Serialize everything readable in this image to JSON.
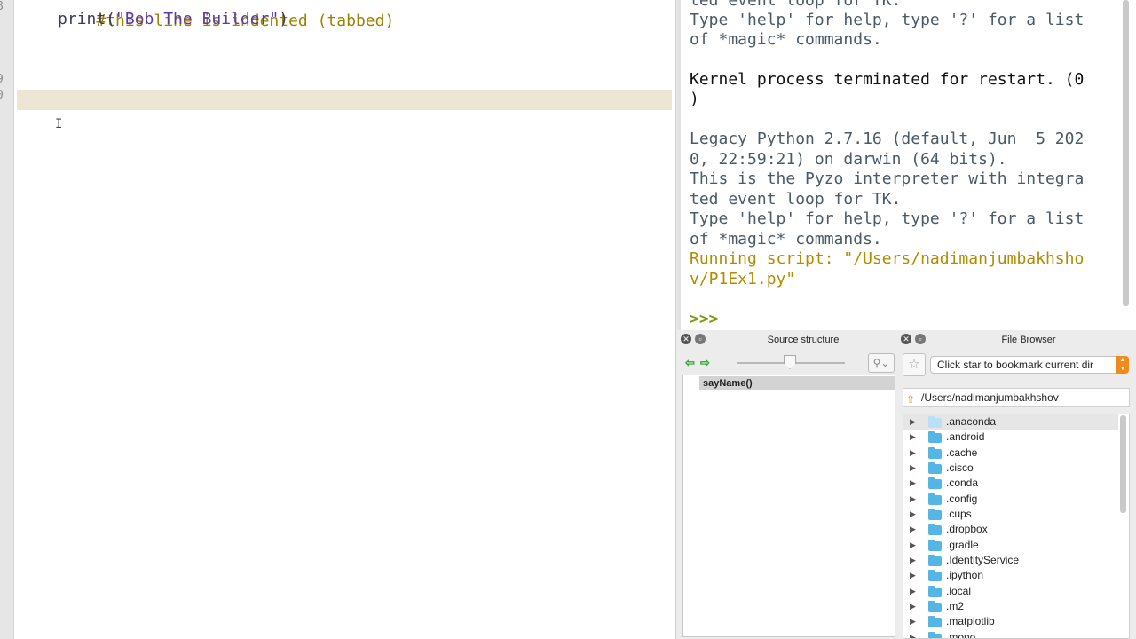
{
  "editor": {
    "code_lines": [
      {
        "comment": "#this line is indented (tabbed)"
      },
      {
        "func": "print",
        "open": "(",
        "string": "\"Bob The Builder\"",
        "close": ")"
      }
    ],
    "line_numbers": [
      "8",
      "9",
      "0"
    ]
  },
  "shell": {
    "lines": [
      {
        "text": "ted event loop for TK.",
        "style": "normal"
      },
      {
        "text": "Type 'help' for help, type '?' for a list",
        "style": "normal"
      },
      {
        "text": "of *magic* commands.",
        "style": "normal"
      },
      {
        "text": "",
        "style": "normal"
      },
      {
        "text": "Kernel process terminated for restart. (0",
        "style": "black"
      },
      {
        "text": ")",
        "style": "black"
      },
      {
        "text": "",
        "style": "normal"
      },
      {
        "text": "Legacy Python 2.7.16 (default, Jun  5 202",
        "style": "normal"
      },
      {
        "text": "0, 22:59:21) on darwin (64 bits).",
        "style": "normal"
      },
      {
        "text": "This is the Pyzo interpreter with integra",
        "style": "normal"
      },
      {
        "text": "ted event loop for TK.",
        "style": "normal"
      },
      {
        "text": "Type 'help' for help, type '?' for a list",
        "style": "normal"
      },
      {
        "text": "of *magic* commands.",
        "style": "normal"
      },
      {
        "text": "Running script: \"/Users/nadimanjumbakhsho",
        "style": "run"
      },
      {
        "text": "v/P1Ex1.py\"",
        "style": "run"
      }
    ],
    "prompt": ">>>"
  },
  "source_structure": {
    "title": "Source structure",
    "items": [
      "sayName()"
    ]
  },
  "file_browser": {
    "title": "File Browser",
    "bookmark_text": "Click star to bookmark current dir",
    "path": "/Users/nadimanjumbakhshov",
    "folders": [
      ".anaconda",
      ".android",
      ".cache",
      ".cisco",
      ".conda",
      ".config",
      ".cups",
      ".dropbox",
      ".gradle",
      ".IdentityService",
      ".ipython",
      ".local",
      ".m2",
      ".matplotlib",
      ".mono"
    ]
  },
  "colors": {
    "current_line": "#ece6d3",
    "comment": "#a08000",
    "string": "#5a3aa8",
    "shell_text": "#4a5a66",
    "running_script": "#b38a00",
    "prompt": "#7a9a10",
    "folder": "#55b6e6",
    "dropdown_accent": "#f08a1c"
  },
  "icons": [
    "close-icon",
    "undock-icon",
    "back-arrow-icon",
    "forward-arrow-icon",
    "filter-icon",
    "star-icon",
    "folder-up-icon",
    "folder-icon",
    "expand-triangle-icon",
    "text-cursor-icon"
  ]
}
